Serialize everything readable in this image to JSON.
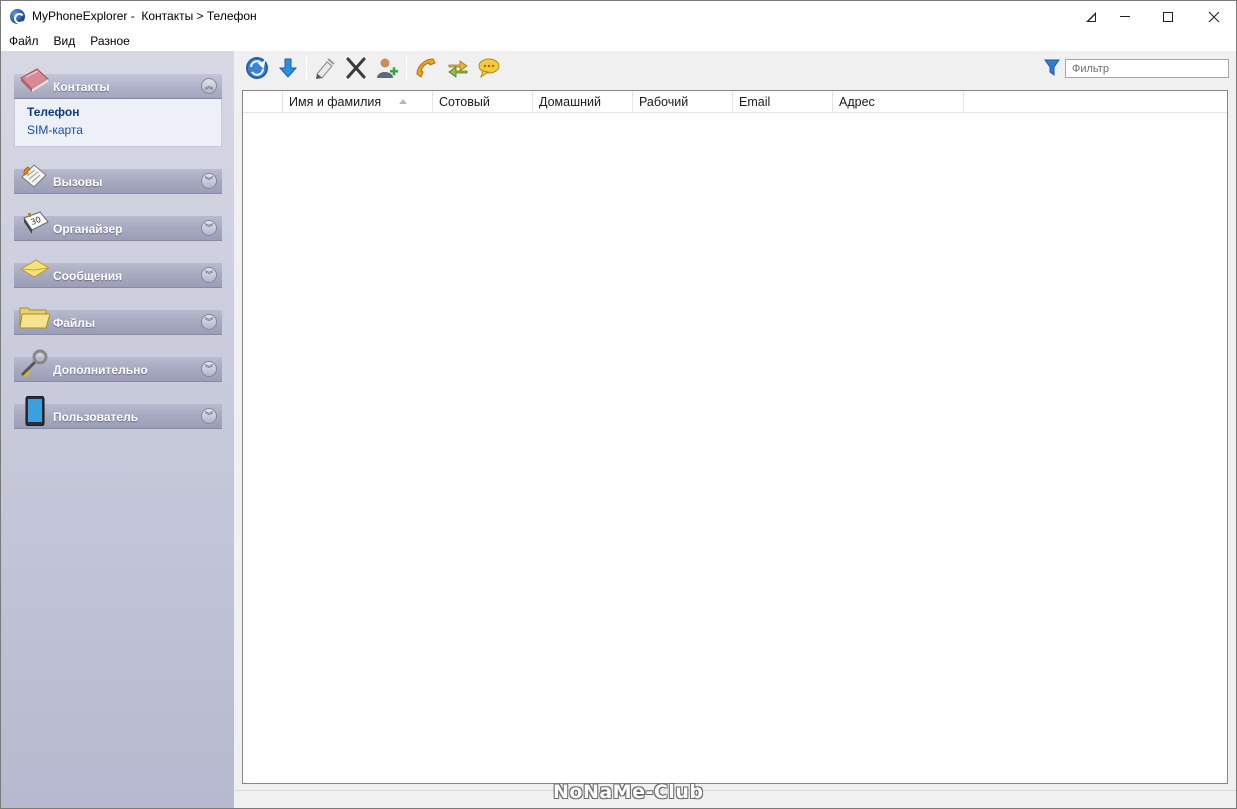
{
  "window": {
    "title": "MyPhoneExplorer -  Контакты > Телефон",
    "controls": {
      "minimize": "—",
      "maximize": "☐",
      "close": "✕"
    }
  },
  "menu": [
    "Файл",
    "Вид",
    "Разное"
  ],
  "sidebar": {
    "sections": [
      {
        "label": "Контакты",
        "icon": "contacts-book-icon",
        "expanded": true,
        "items": [
          {
            "label": "Телефон",
            "active": true
          },
          {
            "label": "SIM-карта",
            "active": false
          }
        ]
      },
      {
        "label": "Вызовы",
        "icon": "calls-icon",
        "expanded": false
      },
      {
        "label": "Органайзер",
        "icon": "organizer-calendar-icon",
        "expanded": false
      },
      {
        "label": "Сообщения",
        "icon": "envelope-icon",
        "expanded": false
      },
      {
        "label": "Файлы",
        "icon": "folder-icon",
        "expanded": false
      },
      {
        "label": "Дополнительно",
        "icon": "tools-icon",
        "expanded": false
      },
      {
        "label": "Пользователь",
        "icon": "phone-device-icon",
        "expanded": false
      }
    ]
  },
  "toolbar": {
    "buttons": [
      "refresh-icon",
      "download-icon",
      "edit-icon",
      "delete-icon",
      "add-contact-icon",
      "call-icon",
      "sync-icon",
      "sms-icon"
    ]
  },
  "filter": {
    "placeholder": "Фильтр"
  },
  "contacts_table": {
    "columns": [
      "Имя и фамилия",
      "Сотовый",
      "Домашний",
      "Рабочий",
      "Email",
      "Адрес"
    ],
    "sorted_column": "Имя и фамилия",
    "rows": []
  },
  "watermark": "NoNaMe-Club",
  "colors": {
    "sidebar": "#c3c6d8",
    "section_header": "#a7a9c0",
    "link": "#1b4fa0",
    "accent": "#1d4e96"
  }
}
